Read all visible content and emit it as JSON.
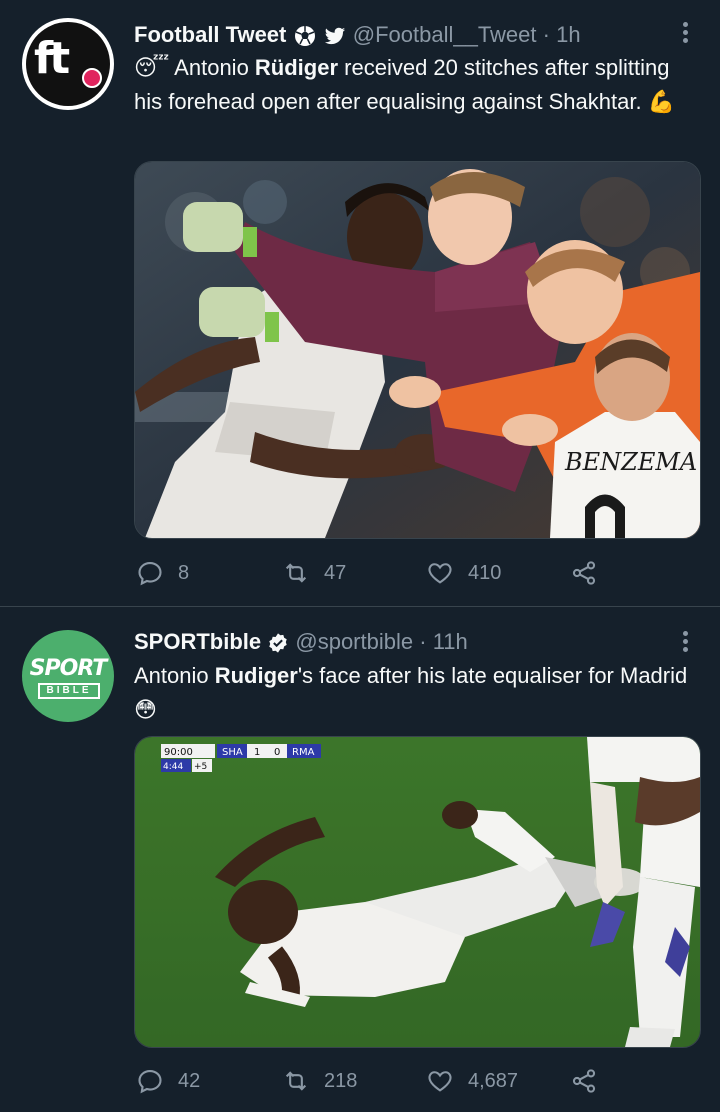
{
  "tweets": [
    {
      "author_name": "Football Tweet",
      "handle": "@Football__Tweet",
      "separator": "·",
      "time": "1h",
      "text_pre": "😴 Antonio ",
      "text_bold": "Rüdiger",
      "text_post": " received 20 stitches after splitting his forehead open after equalising against Shakhtar. 💪",
      "media_caption": "BENZEMA",
      "replies": "8",
      "retweets": "47",
      "likes": "410"
    },
    {
      "author_name": "SPORTbible",
      "handle": "@sportbible",
      "separator": "·",
      "time": "11h",
      "text_pre": "Antonio ",
      "text_bold": "Rudiger",
      "text_post": "'s face after his late equaliser for Madrid 😳",
      "scoreboard": {
        "clock": "90:00",
        "home": "SHA",
        "home_score": "1",
        "away_score": "0",
        "away": "RMA",
        "added_time": "4:44",
        "plus": "+5"
      },
      "replies": "42",
      "retweets": "218",
      "likes": "4,687"
    }
  ],
  "avatars": {
    "football_tweet_logo": "ft",
    "sportbible_top": "SPORT",
    "sportbible_bottom": "BIBLE"
  },
  "colors": {
    "background": "#15202b",
    "text_primary": "#f7f9f9",
    "text_secondary": "#8b98a5",
    "divider": "#38444d",
    "sportbible_green": "#4caf6d"
  }
}
